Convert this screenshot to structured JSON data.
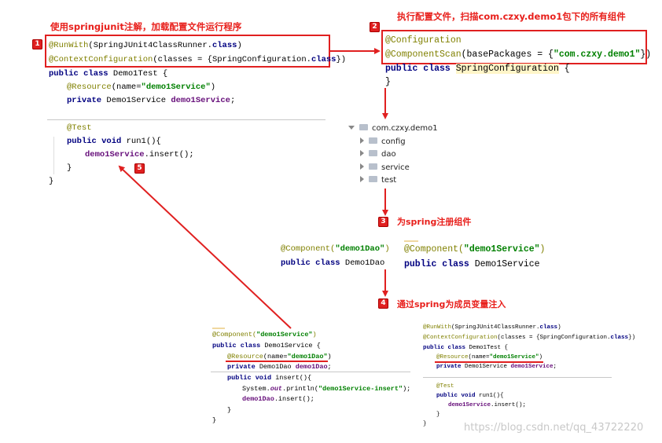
{
  "notes": {
    "n1": "使用springjunit注解，加载配置文件运行程序",
    "n2": "执行配置文件，扫描com.czxy.demo1包下的所有组件",
    "n3": "为spring注册组件",
    "n4": "通过spring为成员变量注入"
  },
  "badges": {
    "b1": "1",
    "b2": "2",
    "b3": "3",
    "b4": "4",
    "b5": "5"
  },
  "test_class": {
    "l1a": "@RunWith",
    "l1b": "(SpringJUnit4ClassRunner.",
    "l1c": "class",
    "l1d": ")",
    "l2a": "@ContextConfiguration",
    "l2b": "(classes = {SpringConfiguration.",
    "l2c": "class",
    "l2d": "})",
    "l3a": "public class",
    "l3b": " Demo1Test {",
    "l4a": "@Resource",
    "l4b": "(name=",
    "l4c": "\"demo1Service\"",
    "l4d": ")",
    "l5a": "private",
    "l5b": " Demo1Service ",
    "l5c": "demo1Service",
    "l5d": ";",
    "l6": "@Test",
    "l7a": "public void",
    "l7b": " run1(){",
    "l8a": "demo1Service",
    "l8b": ".insert();",
    "l9": "}",
    "l10": "}"
  },
  "config_class": {
    "l1": "@Configuration",
    "l2a": "@ComponentScan",
    "l2b": "(basePackages = {",
    "l2c": "\"com.czxy.demo1\"",
    "l2d": "})",
    "l3a": "public class",
    "l3b": " ",
    "l3c": "SpringConfiguration",
    "l3d": " {",
    "l4": "}"
  },
  "tree": {
    "root": "com.czxy.demo1",
    "items": [
      "config",
      "dao",
      "service",
      "test"
    ]
  },
  "components": {
    "dao_a": "@Component(",
    "dao_b": "\"demo1Dao\"",
    "dao_c": ")",
    "dao_d": "public class",
    "dao_e": " Demo1Dao",
    "svc_a": "@Component(",
    "svc_b": "\"demo1Service\"",
    "svc_c": ")",
    "svc_d": "public class",
    "svc_e": " Demo1Service"
  },
  "service_impl": {
    "l1a": "@Component(",
    "l1b": "\"demo1Service\"",
    "l1c": ")",
    "l2a": "public class",
    "l2b": " Demo1Service {",
    "l3a": "@Resource",
    "l3b": "(name=",
    "l3c": "\"demo1Dao\"",
    "l3d": ")",
    "l4a": "private",
    "l4b": " Demo1Dao ",
    "l4c": "demo1Dao",
    "l4d": ";",
    "l5a": "public void",
    "l5b": " insert(){",
    "l6a": "System.",
    "l6b": "out",
    "l6c": ".println(",
    "l6d": "\"demo1Service-insert\"",
    "l6e": ");",
    "l7a": "demo1Dao",
    "l7b": ".insert();",
    "l8": "}",
    "l9": "}"
  },
  "test_small": {
    "l1a": "@RunWith",
    "l1b": "(SpringJUnit4ClassRunner.",
    "l1c": "class",
    "l1d": ")",
    "l2a": "@ContextConfiguration",
    "l2b": "(classes = {SpringConfiguration.",
    "l2c": "class",
    "l2d": "})",
    "l3a": "public class",
    "l3b": " Demo1Test {",
    "l4a": "@Resource",
    "l4b": "(name=",
    "l4c": "\"demo1Service\"",
    "l4d": ")",
    "l5a": "private",
    "l5b": " Demo1Service ",
    "l5c": "demo1Service",
    "l5d": ";",
    "l6": "@Test",
    "l7a": "public void",
    "l7b": " run1(){",
    "l8a": "demo1Service",
    "l8b": ".insert();",
    "l9": "}",
    "l10": "}"
  },
  "watermark": "https://blog.csdn.net/qq_43722220",
  "colors": {
    "accent_red": "#e02020",
    "keyword": "#000080",
    "annotation": "#808000",
    "string": "#008000",
    "field": "#660e7a"
  }
}
